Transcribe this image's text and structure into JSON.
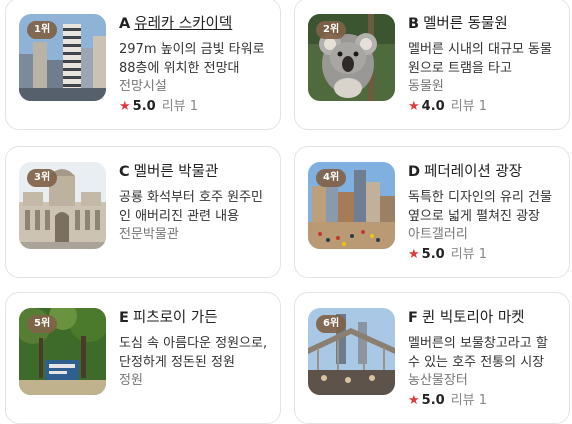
{
  "attractions": [
    {
      "rank": "1위",
      "letter": "A",
      "name": "유레카 스카이덱",
      "desc": "297m 높이의 금빛 타워로 88층에 위치한 전망대",
      "category": "전망시설",
      "rating": "5.0",
      "reviews": "리뷰 1"
    },
    {
      "rank": "2위",
      "letter": "B",
      "name": "멜버른 동물원",
      "desc": "멜버른 시내의 대규모 동물원으로 트램을 타고",
      "category": "동물원",
      "rating": "4.0",
      "reviews": "리뷰 1"
    },
    {
      "rank": "3위",
      "letter": "C",
      "name": "멜버른 박물관",
      "desc": "공룡 화석부터 호주 원주민인 애버리진 관련 내용",
      "category": "전문박물관"
    },
    {
      "rank": "4위",
      "letter": "D",
      "name": "페더레이션 광장",
      "desc": "독특한 디자인의 유리 건물 옆으로 넓게 펼쳐진 광장",
      "category": "아트갤러리",
      "rating": "5.0",
      "reviews": "리뷰 1"
    },
    {
      "rank": "5위",
      "letter": "E",
      "name": "피츠로이 가든",
      "desc": "도심 속 아름다운 정원으로, 단정하게 정돈된 정원",
      "category": "정원"
    },
    {
      "rank": "6위",
      "letter": "F",
      "name": "퀸 빅토리아 마켓",
      "desc": "멜버른의 보물창고라고 할 수 있는 호주 전통의 시장",
      "category": "농산물장터",
      "rating": "5.0",
      "reviews": "리뷰 1"
    }
  ],
  "icons": {
    "star": "star-icon"
  },
  "colors": {
    "star": "#e03a3e",
    "rank_badge": "#806248"
  }
}
